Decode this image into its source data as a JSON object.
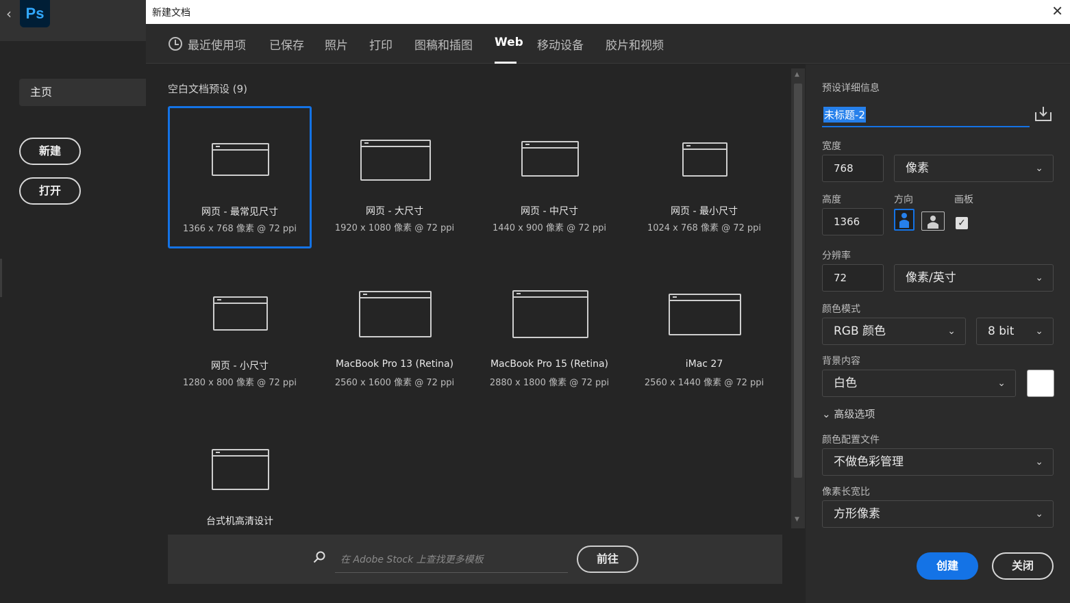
{
  "home": {
    "logo": "Ps",
    "nav_home": "主页",
    "new_label": "新建",
    "open_label": "打开"
  },
  "dialog": {
    "title": "新建文档",
    "close_glyph": "✕"
  },
  "tabs": [
    {
      "label": "最近使用项",
      "active": false
    },
    {
      "label": "已保存",
      "active": false
    },
    {
      "label": "照片",
      "active": false
    },
    {
      "label": "打印",
      "active": false
    },
    {
      "label": "图稿和插图",
      "active": false
    },
    {
      "label": "Web",
      "active": true
    },
    {
      "label": "移动设备",
      "active": false
    },
    {
      "label": "胶片和视频",
      "active": false
    }
  ],
  "presets": {
    "section_title": "空白文档预设 (9)",
    "items": [
      {
        "name": "网页 - 最常见尺寸",
        "dims": "1366 x 768 像素 @ 72 ppi",
        "selected": true
      },
      {
        "name": "网页 - 大尺寸",
        "dims": "1920 x 1080 像素 @ 72 ppi",
        "selected": false
      },
      {
        "name": "网页 - 中尺寸",
        "dims": "1440 x 900 像素 @ 72 ppi",
        "selected": false
      },
      {
        "name": "网页 - 最小尺寸",
        "dims": "1024 x 768 像素 @ 72 ppi",
        "selected": false
      },
      {
        "name": "网页 - 小尺寸",
        "dims": "1280 x 800 像素 @ 72 ppi",
        "selected": false
      },
      {
        "name": "MacBook Pro 13 (Retina)",
        "dims": "2560 x 1600 像素 @ 72 ppi",
        "selected": false
      },
      {
        "name": "MacBook Pro 15 (Retina)",
        "dims": "2880 x 1800 像素 @ 72 ppi",
        "selected": false
      },
      {
        "name": "iMac 27",
        "dims": "2560 x 1440 像素 @ 72 ppi",
        "selected": false
      },
      {
        "name": "台式机高清设计",
        "dims": "",
        "selected": false
      }
    ]
  },
  "stock": {
    "placeholder": "在 Adobe Stock 上查找更多模板",
    "go_label": "前往"
  },
  "details": {
    "section_title": "预设详细信息",
    "doc_name": "未标题-2",
    "width_label": "宽度",
    "width_value": "768",
    "width_unit": "像素",
    "height_label": "高度",
    "height_value": "1366",
    "orientation_label": "方向",
    "artboard_label": "画板",
    "artboard_checked": true,
    "resolution_label": "分辨率",
    "resolution_value": "72",
    "resolution_unit": "像素/英寸",
    "color_mode_label": "颜色模式",
    "color_mode": "RGB 颜色",
    "bit_depth": "8 bit",
    "background_label": "背景内容",
    "background": "白色",
    "background_color": "#ffffff",
    "advanced_label": "高级选项",
    "color_profile_label": "颜色配置文件",
    "color_profile": "不做色彩管理",
    "pixel_aspect_label": "像素长宽比",
    "pixel_aspect": "方形像素",
    "create_label": "创建",
    "close_label": "关闭"
  },
  "colors": {
    "accent": "#1473e6",
    "panel": "#2b2b2b",
    "background": "#252525"
  }
}
